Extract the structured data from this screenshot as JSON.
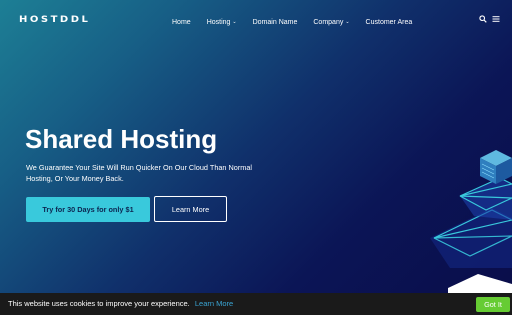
{
  "brand": {
    "logo_text": "HOSTDDL"
  },
  "nav": {
    "items": [
      {
        "label": "Home",
        "has_dropdown": false
      },
      {
        "label": "Hosting",
        "has_dropdown": true
      },
      {
        "label": "Domain Name",
        "has_dropdown": false
      },
      {
        "label": "Company",
        "has_dropdown": true
      },
      {
        "label": "Customer Area",
        "has_dropdown": false
      }
    ],
    "icons": [
      "search-icon",
      "menu-icon"
    ]
  },
  "hero": {
    "title": "Shared Hosting",
    "subtitle": "We Guarantee Your Site Will Run Quicker On Our Cloud Than Normal Hosting, Or Your Money Back.",
    "primary_button": "Try for 30 Days for only $1",
    "secondary_button": "Learn More"
  },
  "cookie_bar": {
    "text": "This website uses cookies to improve your experience.",
    "link": "Learn More",
    "button": "Got It"
  },
  "colors": {
    "accent": "#39c9dc",
    "hero_dark": "#0a0d4a",
    "hero_teal": "#1d7f95",
    "cookie_bg": "#1a1a1a",
    "cookie_link": "#3aa5d4",
    "gotit_green": "#66cc33"
  }
}
